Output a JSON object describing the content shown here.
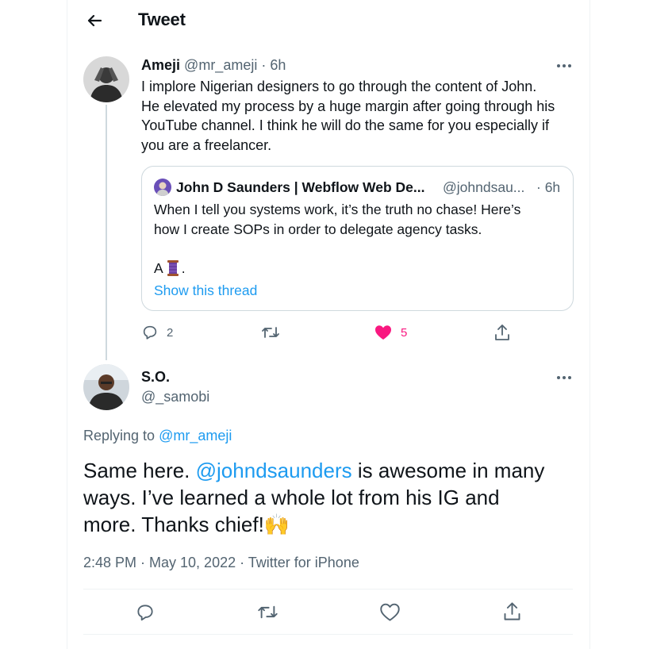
{
  "header": {
    "title": "Tweet"
  },
  "parent_tweet": {
    "author_name": "Ameji",
    "author_handle": "@mr_ameji",
    "time": "· 6h",
    "text_lines": [
      "I implore Nigerian designers to go through the content of John.",
      "He elevated my process by a huge margin after going through his",
      "YouTube channel. I think he will do the same for you especially if",
      "you are a freelancer."
    ],
    "quote": {
      "author_name": "John D Saunders | Webflow Web De...",
      "author_handle": "@johndsau...",
      "time": "· 6h",
      "line1": "When I tell you systems work, it’s the truth no chase! Here’s",
      "line2": "how I create SOPs in order to delegate agency tasks.",
      "line3": "A",
      "line3_end": ".",
      "show_thread": "Show this thread"
    },
    "actions": {
      "replies": "2",
      "likes": "5"
    }
  },
  "main_tweet": {
    "author_name": "S.O.",
    "author_handle": "@_samobi",
    "replying_prefix": "Replying to",
    "replying_handle": "@mr_ameji",
    "text_line1_a": "Same here.",
    "text_mention": "@johndsaunders",
    "text_line1_b": "is awesome in many",
    "text_line2": "ways. I’ve learned a whole lot from his IG and",
    "text_line3": "more. Thanks chief!",
    "text_emoji": "🙌",
    "timestamp": "2:48 PM · May 10, 2022 · Twitter for iPhone"
  },
  "colors": {
    "accent": "#1d9bf0",
    "like": "#f91880",
    "muted": "#536471",
    "border": "#cfd9de"
  },
  "icons": [
    "back-arrow-icon",
    "more-icon",
    "reply-icon",
    "retweet-icon",
    "like-icon",
    "share-icon",
    "spool-emoji",
    "raising-hands-emoji"
  ]
}
